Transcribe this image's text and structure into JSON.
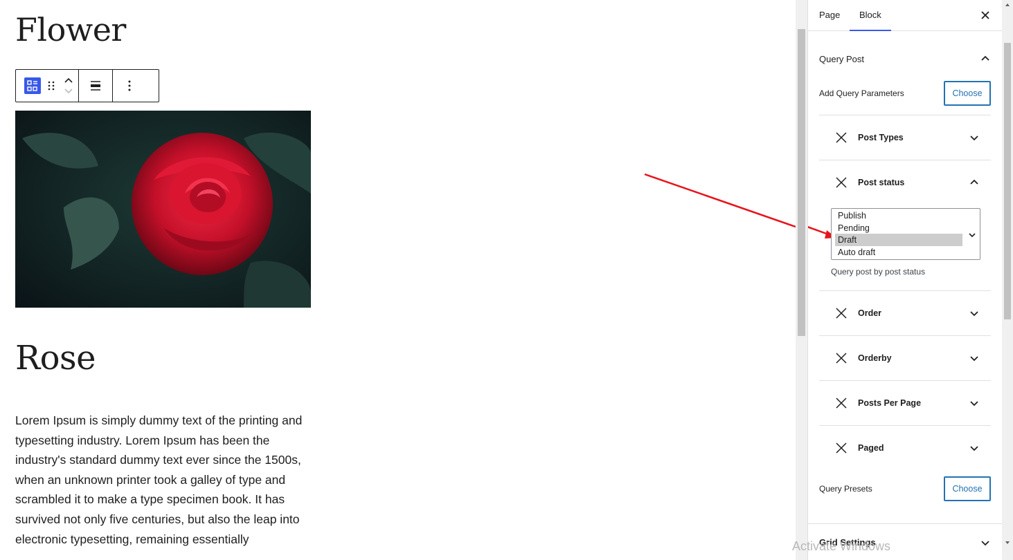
{
  "canvas": {
    "page_title": "Flower",
    "post_title": "Rose",
    "excerpt": "Lorem Ipsum is simply dummy text of the printing and typesetting industry. Lorem Ipsum has been the industry's standard dummy text ever since the 1500s, when an unknown printer took a galley of type and scrambled it to make a type specimen book. It has survived not only five centuries, but also the leap into electronic typesetting, remaining essentially",
    "block_toolbar": {
      "block_icon": "query-loop-icon",
      "drag_icon": "drag-handle-icon",
      "move_up_icon": "chevron-up-icon",
      "move_down_icon": "chevron-down-icon",
      "align_icon": "align-wide-icon",
      "more_icon": "more-vertical-icon"
    }
  },
  "sidebar": {
    "tabs": [
      {
        "label": "Page",
        "active": false
      },
      {
        "label": "Block",
        "active": true
      }
    ],
    "close_icon": "close-icon",
    "panel_title": "Query Post",
    "add_params_label": "Add Query Parameters",
    "choose_label": "Choose",
    "items": [
      {
        "label": "Post Types",
        "expanded": false
      },
      {
        "label": "Post status",
        "expanded": true
      },
      {
        "label": "Order",
        "expanded": false
      },
      {
        "label": "Orderby",
        "expanded": false
      },
      {
        "label": "Posts Per Page",
        "expanded": false
      },
      {
        "label": "Paged",
        "expanded": false
      }
    ],
    "post_status": {
      "options": [
        "Publish",
        "Pending",
        "Draft",
        "Auto draft"
      ],
      "selected": "Draft",
      "help": "Query post by post status"
    },
    "query_presets_label": "Query Presets",
    "query_presets_choose": "Choose",
    "next_panel": "Grid Settings"
  },
  "overlay": {
    "watermark": "Activate Windows",
    "arrow_color": "#e8141b"
  },
  "colors": {
    "accent": "#3858e9",
    "button_blue": "#2271b1"
  }
}
